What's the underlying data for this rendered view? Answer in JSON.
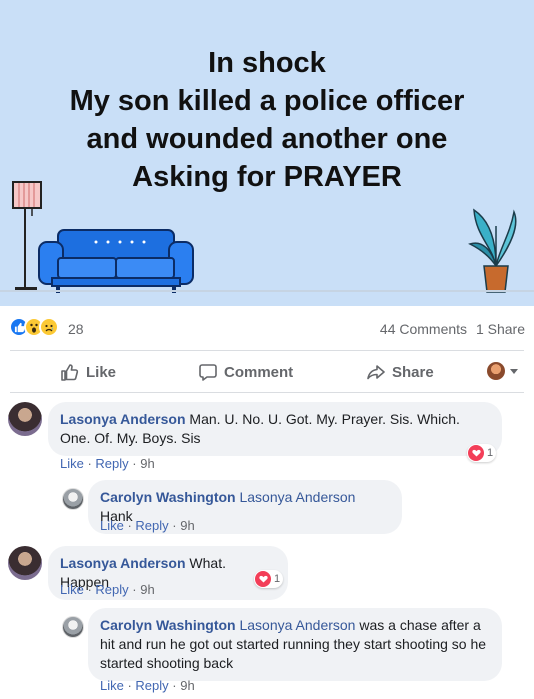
{
  "post": {
    "text": "In shock\nMy son killed a police officer\nand wounded another one\nAsking for PRAYER"
  },
  "summary": {
    "reactions": [
      "like",
      "wow",
      "sad"
    ],
    "reaction_count": "28",
    "comments": "44 Comments",
    "shares": "1 Share"
  },
  "actions": {
    "like": "Like",
    "comment": "Comment",
    "share": "Share"
  },
  "comments": [
    {
      "author": "Lasonya Anderson",
      "text": "Man. U. No. U. Got. My. Prayer. Sis. Which. One. Of. My. Boys. Sis",
      "like": "Like",
      "reply": "Reply",
      "time": "9h",
      "reaction_count": "1"
    },
    {
      "author": "Carolyn Washington",
      "mention": "Lasonya Anderson",
      "text": "Hank",
      "like": "Like",
      "reply": "Reply",
      "time": "9h"
    },
    {
      "author": "Lasonya Anderson",
      "text": "What. Happen",
      "like": "Like",
      "reply": "Reply",
      "time": "9h",
      "reaction_count": "1"
    },
    {
      "author": "Carolyn Washington",
      "mention": "Lasonya Anderson",
      "text": "was a chase after a hit and run he got out started running they start shooting so he started shooting back",
      "like": "Like",
      "reply": "Reply",
      "time": "9h"
    }
  ],
  "colors": {
    "post_background": "#c9dff7",
    "sofa": "#1d6fe0",
    "link": "#365899",
    "heart": "#f33e58",
    "like_blue": "#1877f2"
  }
}
